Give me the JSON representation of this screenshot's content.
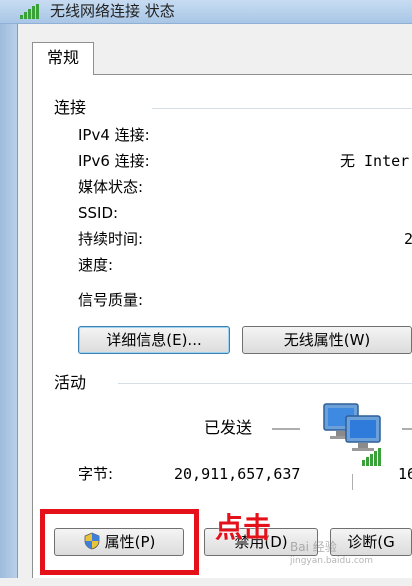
{
  "window": {
    "title": "无线网络连接 状态"
  },
  "tabs": [
    {
      "label": "常规",
      "selected": true
    }
  ],
  "connection": {
    "section_title": "连接",
    "rows": [
      {
        "label": "IPv4 连接:",
        "value": ""
      },
      {
        "label": "IPv6 连接:",
        "value": "无 Inter"
      },
      {
        "label": "媒体状态:",
        "value": ""
      },
      {
        "label": "SSID:",
        "value": ""
      },
      {
        "label": "持续时间:",
        "value": "2"
      },
      {
        "label": "速度:",
        "value": ""
      }
    ],
    "signal_label": "信号质量:"
  },
  "buttons": {
    "details": "详细信息(E)...",
    "wireless_properties": "无线属性(W)",
    "properties": "属性(P)",
    "disable": "禁用(D)",
    "diagnose": "诊断(G"
  },
  "activity": {
    "section_title": "活动",
    "sent_label": "已发送",
    "bytes_label": "字节:",
    "bytes_sent": "20,911,657,637",
    "bytes_received": "16"
  },
  "annotation": {
    "text": "点击",
    "color": "#e4101a"
  },
  "watermark": {
    "line1": "Bai 经验",
    "line2": "jingyan.baidu.com"
  },
  "icons": {
    "title": "wireless-signal-icon",
    "properties_button": "shield-icon",
    "activity": "network-computers-icon"
  }
}
